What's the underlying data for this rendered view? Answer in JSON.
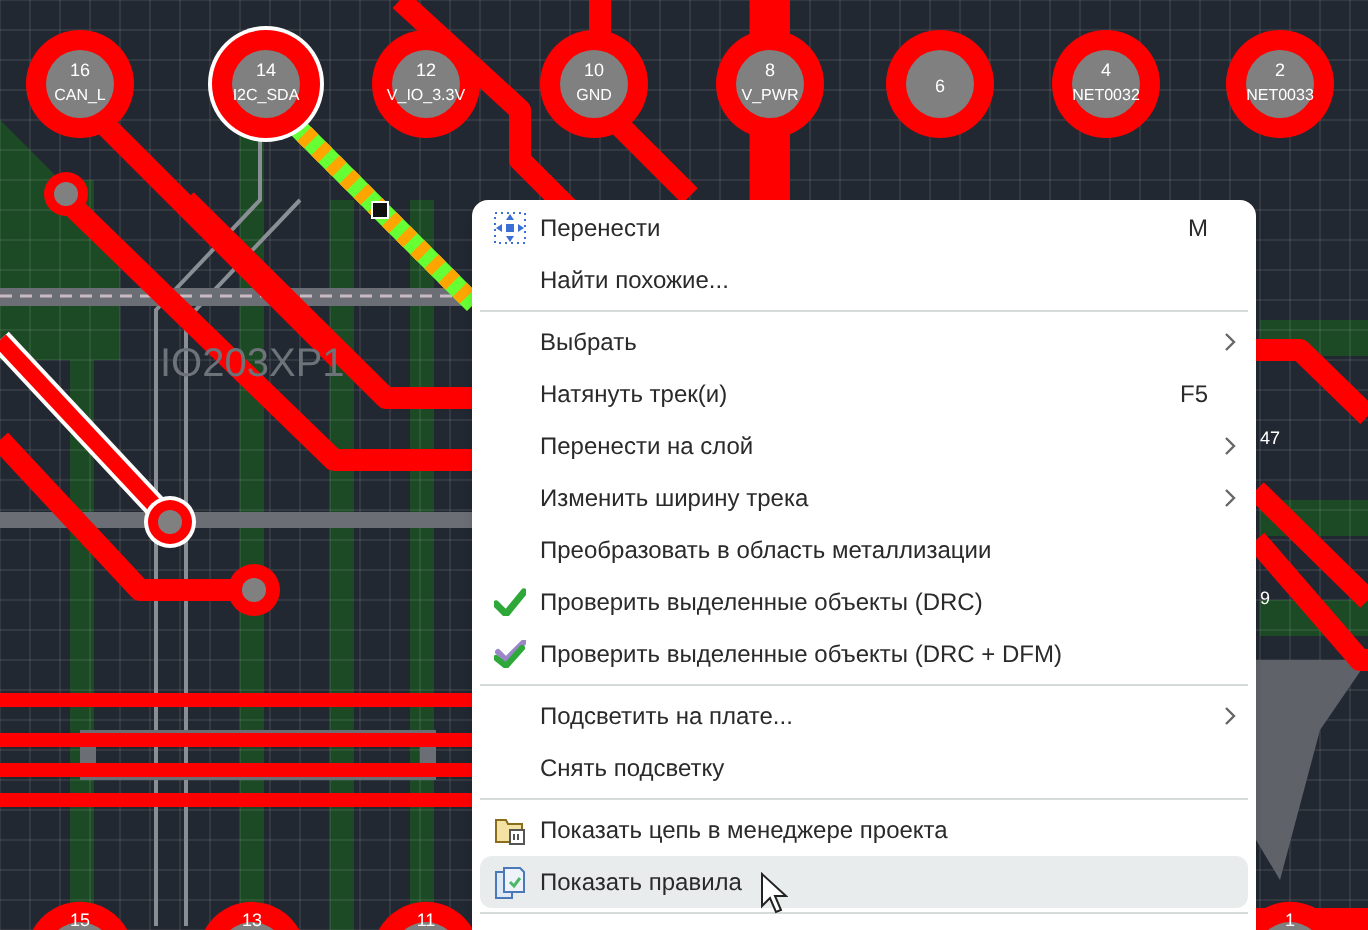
{
  "pcb": {
    "top_pads": [
      {
        "number": "16",
        "net": "CAN_L",
        "selected": false
      },
      {
        "number": "14",
        "net": "I2C_SDA",
        "selected": true
      },
      {
        "number": "12",
        "net": "V_IO_3.3V",
        "selected": false
      },
      {
        "number": "10",
        "net": "GND",
        "selected": false
      },
      {
        "number": "8",
        "net": "V_PWR",
        "selected": false
      },
      {
        "number": "6",
        "selected": false
      },
      {
        "number": "4",
        "net": "NET0032",
        "selected": false
      },
      {
        "number": "2",
        "net": "NET0033",
        "selected": false
      }
    ],
    "bottom_pads": [
      {
        "number": "15"
      },
      {
        "number": "13"
      },
      {
        "number": "11"
      },
      {
        "number": "1"
      }
    ],
    "silkscreen": "IO203XP1",
    "component_labels": [
      "47",
      "9"
    ]
  },
  "menu": {
    "items": [
      {
        "kind": "item",
        "label": "Перенести",
        "shortcut": "M",
        "submenu": false,
        "highlighted": false
      },
      {
        "kind": "item",
        "label": "Найти похожие...",
        "submenu": false,
        "highlighted": false
      },
      {
        "kind": "separator"
      },
      {
        "kind": "item",
        "label": "Выбрать",
        "submenu": true,
        "highlighted": false
      },
      {
        "kind": "item",
        "label": "Натянуть трек(и)",
        "shortcut": "F5",
        "submenu": false,
        "highlighted": false
      },
      {
        "kind": "item",
        "label": "Перенести на слой",
        "submenu": true,
        "highlighted": false
      },
      {
        "kind": "item",
        "label": "Изменить ширину трека",
        "submenu": true,
        "highlighted": false
      },
      {
        "kind": "item",
        "label": "Преобразовать в область металлизации",
        "submenu": false,
        "highlighted": false
      },
      {
        "kind": "item",
        "label": "Проверить выделенные объекты (DRC)",
        "submenu": false,
        "highlighted": false
      },
      {
        "kind": "item",
        "label": "Проверить выделенные объекты (DRC + DFM)",
        "submenu": false,
        "highlighted": false
      },
      {
        "kind": "separator"
      },
      {
        "kind": "item",
        "label": "Подсветить на плате...",
        "submenu": true,
        "highlighted": false
      },
      {
        "kind": "item",
        "label": "Снять подсветку",
        "submenu": false,
        "highlighted": false
      },
      {
        "kind": "separator"
      },
      {
        "kind": "item",
        "label": "Показать цепь в менеджере проекта",
        "submenu": false,
        "highlighted": false
      },
      {
        "kind": "item",
        "label": "Показать правила",
        "submenu": false,
        "highlighted": true
      },
      {
        "kind": "separator"
      }
    ]
  }
}
